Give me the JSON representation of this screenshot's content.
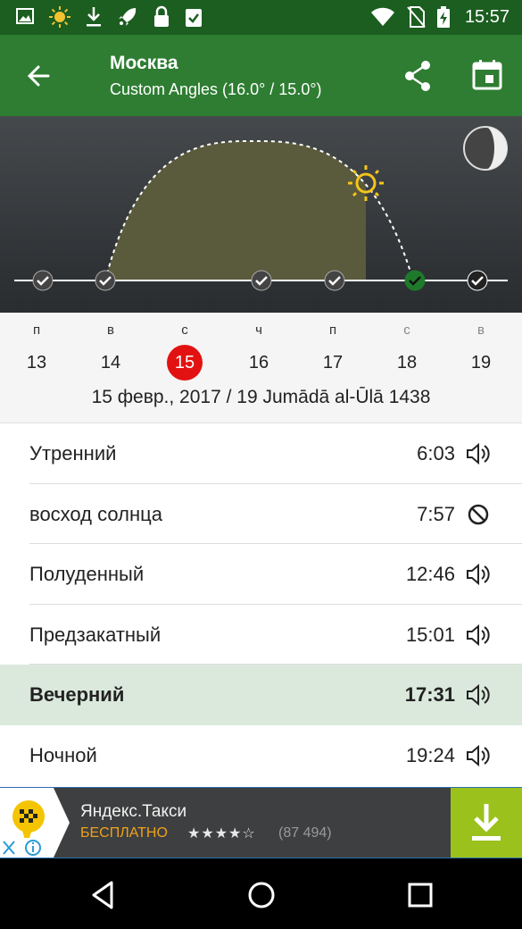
{
  "status_bar": {
    "time": "15:57"
  },
  "app_bar": {
    "title": "Москва",
    "subtitle": "Custom Angles (16.0° / 15.0°)"
  },
  "days": [
    {
      "weekday": "п",
      "date": "13"
    },
    {
      "weekday": "в",
      "date": "14"
    },
    {
      "weekday": "с",
      "date": "15",
      "selected": true
    },
    {
      "weekday": "ч",
      "date": "16"
    },
    {
      "weekday": "п",
      "date": "17"
    },
    {
      "weekday": "с",
      "date": "18"
    },
    {
      "weekday": "в",
      "date": "19"
    }
  ],
  "date_line": "15 февр., 2017 / 19 Jumādā al-Ūlā 1438",
  "prayers": [
    {
      "name": "Утренний",
      "time": "6:03",
      "icon": "speaker-icon"
    },
    {
      "name": "восход солнца",
      "time": "7:57",
      "icon": "block-icon"
    },
    {
      "name": "Полуденный",
      "time": "12:46",
      "icon": "speaker-icon"
    },
    {
      "name": "Предзакатный",
      "time": "15:01",
      "icon": "speaker-icon"
    },
    {
      "name": "Вечерний",
      "time": "17:31",
      "icon": "speaker-icon",
      "active": true
    },
    {
      "name": "Ночной",
      "time": "19:24",
      "icon": "speaker-icon"
    }
  ],
  "ad": {
    "title": "Яндекс.Такси",
    "price": "БЕСПЛАТНО",
    "stars": "★★★★☆",
    "reviews": "(87 494)"
  },
  "colors": {
    "status": "#1b5e20",
    "appbar": "#2e7d32",
    "selected_day": "#e31212",
    "active_row": "#dbe9dd",
    "ad_download": "#9bc21c"
  }
}
